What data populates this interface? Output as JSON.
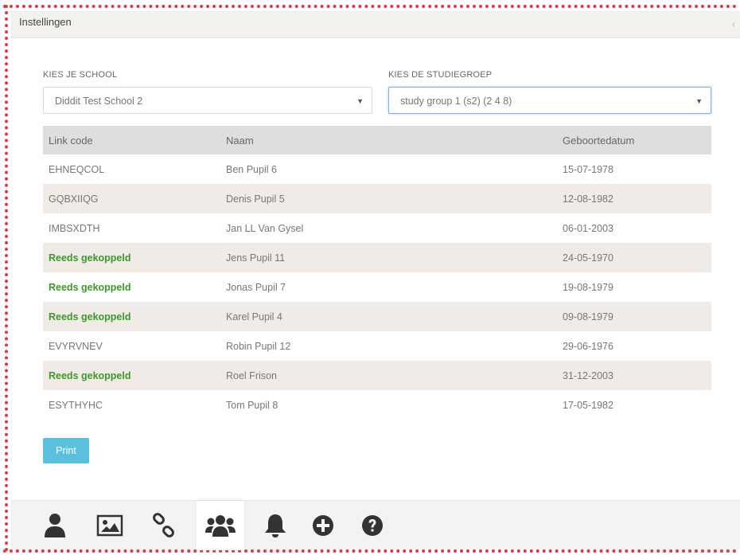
{
  "panel": {
    "title": "Instellingen",
    "collapse_symbol": "‹"
  },
  "school_select": {
    "label": "KIES JE SCHOOL",
    "value": "Diddit Test School 2"
  },
  "group_select": {
    "label": "KIES DE STUDIEGROEP",
    "value": "study group 1 (s2) (2 4 8)"
  },
  "table": {
    "headers": [
      "Link code",
      "Naam",
      "Geboortedatum"
    ],
    "rows": [
      {
        "code": "EHNEQCOL",
        "name": "Ben Pupil 6",
        "dob": "15-07-1978"
      },
      {
        "code": "GQBXIIQG",
        "name": "Denis Pupil 5",
        "dob": "12-08-1982"
      },
      {
        "code": "IMBSXDTH",
        "name": "Jan LL Van Gysel",
        "dob": "06-01-2003"
      },
      {
        "code": "Reeds gekoppeld",
        "name": "Jens Pupil 11",
        "dob": "24-05-1970"
      },
      {
        "code": "Reeds gekoppeld",
        "name": "Jonas Pupil 7",
        "dob": "19-08-1979"
      },
      {
        "code": "Reeds gekoppeld",
        "name": "Karel Pupil 4",
        "dob": "09-08-1979"
      },
      {
        "code": "EVYRVNEV",
        "name": "Robin Pupil 12",
        "dob": "29-06-1976"
      },
      {
        "code": "Reeds gekoppeld",
        "name": "Roel Frison",
        "dob": "31-12-2003"
      },
      {
        "code": "ESYTHYHC",
        "name": "Tom Pupil 8",
        "dob": "17-05-1982"
      }
    ]
  },
  "print_label": "Print",
  "toolbar": {
    "items": [
      "user-icon",
      "image-icon",
      "link-icon",
      "users-icon",
      "bell-icon",
      "plus-circle-icon",
      "question-circle-icon"
    ],
    "active": "users-icon"
  },
  "colors": {
    "linked_text": "#3a9a28",
    "print_button": "#5bc0de",
    "frame_dots": "#e0393b",
    "row_alt": "#f0ebe6"
  }
}
